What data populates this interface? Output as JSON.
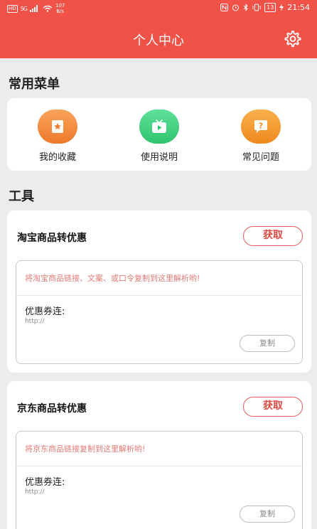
{
  "status_bar": {
    "hd": "HD",
    "signal": "5G",
    "speed_value": "107",
    "speed_unit": "B/s",
    "battery": "13",
    "time": "21:54"
  },
  "header": {
    "title": "个人中心",
    "settings_icon": "gear-icon"
  },
  "common_menu": {
    "title": "常用菜单",
    "items": [
      {
        "label": "我的收藏",
        "icon": "star-bookmark-icon",
        "color": "#f08a3c"
      },
      {
        "label": "使用说明",
        "icon": "tv-play-icon",
        "color": "#3ccf7a"
      },
      {
        "label": "常见问题",
        "icon": "question-bubble-icon",
        "color": "#f29a2e"
      }
    ]
  },
  "tools": {
    "title": "工具",
    "cards": [
      {
        "title": "淘宝商品转优惠",
        "get_label": "获取",
        "placeholder": "将淘宝商品链接、文案、或口令复制到这里解析哟!",
        "coupon_label": "优惠券连:",
        "url": "http://",
        "copy_label": "复制"
      },
      {
        "title": "京东商品转优惠",
        "get_label": "获取",
        "placeholder": "将京东商品链接复制到这里解析哟!",
        "coupon_label": "优惠券连:",
        "url": "http://",
        "copy_label": "复制"
      }
    ]
  },
  "colors": {
    "brand": "#f05248",
    "accent_text": "#e04a44",
    "background": "#ececec"
  }
}
